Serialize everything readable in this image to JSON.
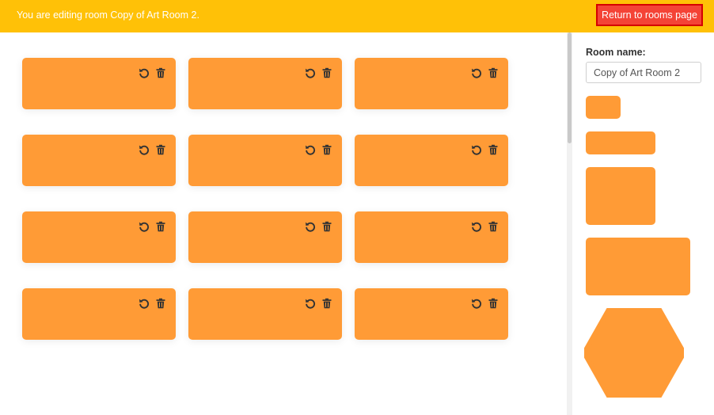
{
  "topbar": {
    "message": "You are editing room Copy of Art Room 2.",
    "return_button": "Return to rooms page"
  },
  "tables": [
    {
      "id": 1
    },
    {
      "id": 2
    },
    {
      "id": 3
    },
    {
      "id": 4
    },
    {
      "id": 5
    },
    {
      "id": 6
    },
    {
      "id": 7
    },
    {
      "id": 8
    },
    {
      "id": 9
    },
    {
      "id": 10
    },
    {
      "id": 11
    },
    {
      "id": 12
    }
  ],
  "sidebar": {
    "room_name_label": "Room name:",
    "room_name_value": "Copy of Art Room 2",
    "shapes": [
      "small-square",
      "wide-rectangle",
      "square",
      "large-rectangle",
      "hexagon"
    ]
  },
  "colors": {
    "topbar": "#FFC107",
    "accent_button": "#F44336",
    "table": "#FF9B36",
    "icon": "#333333"
  },
  "icons": {
    "rotate": "rotate-icon",
    "trash": "trash-icon"
  }
}
